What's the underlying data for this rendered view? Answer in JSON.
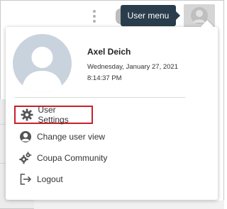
{
  "tooltip": {
    "text": "User menu"
  },
  "profile": {
    "name": "Axel Deich",
    "date": "Wednesday, January 27, 2021",
    "time": "8:14:37 PM"
  },
  "menu": {
    "items": [
      {
        "label": "User Settings",
        "icon": "gear-icon",
        "highlighted": true
      },
      {
        "label": "Change user view",
        "icon": "user-circle-icon"
      },
      {
        "label": "Coupa Community",
        "icon": "community-gears-icon"
      },
      {
        "label": "Logout",
        "icon": "logout-icon"
      }
    ]
  },
  "colors": {
    "tooltip_bg": "#2a3d4c",
    "highlight_border": "#c8202a",
    "avatar_bg": "#c9d3dd",
    "icon_color": "#555555"
  }
}
